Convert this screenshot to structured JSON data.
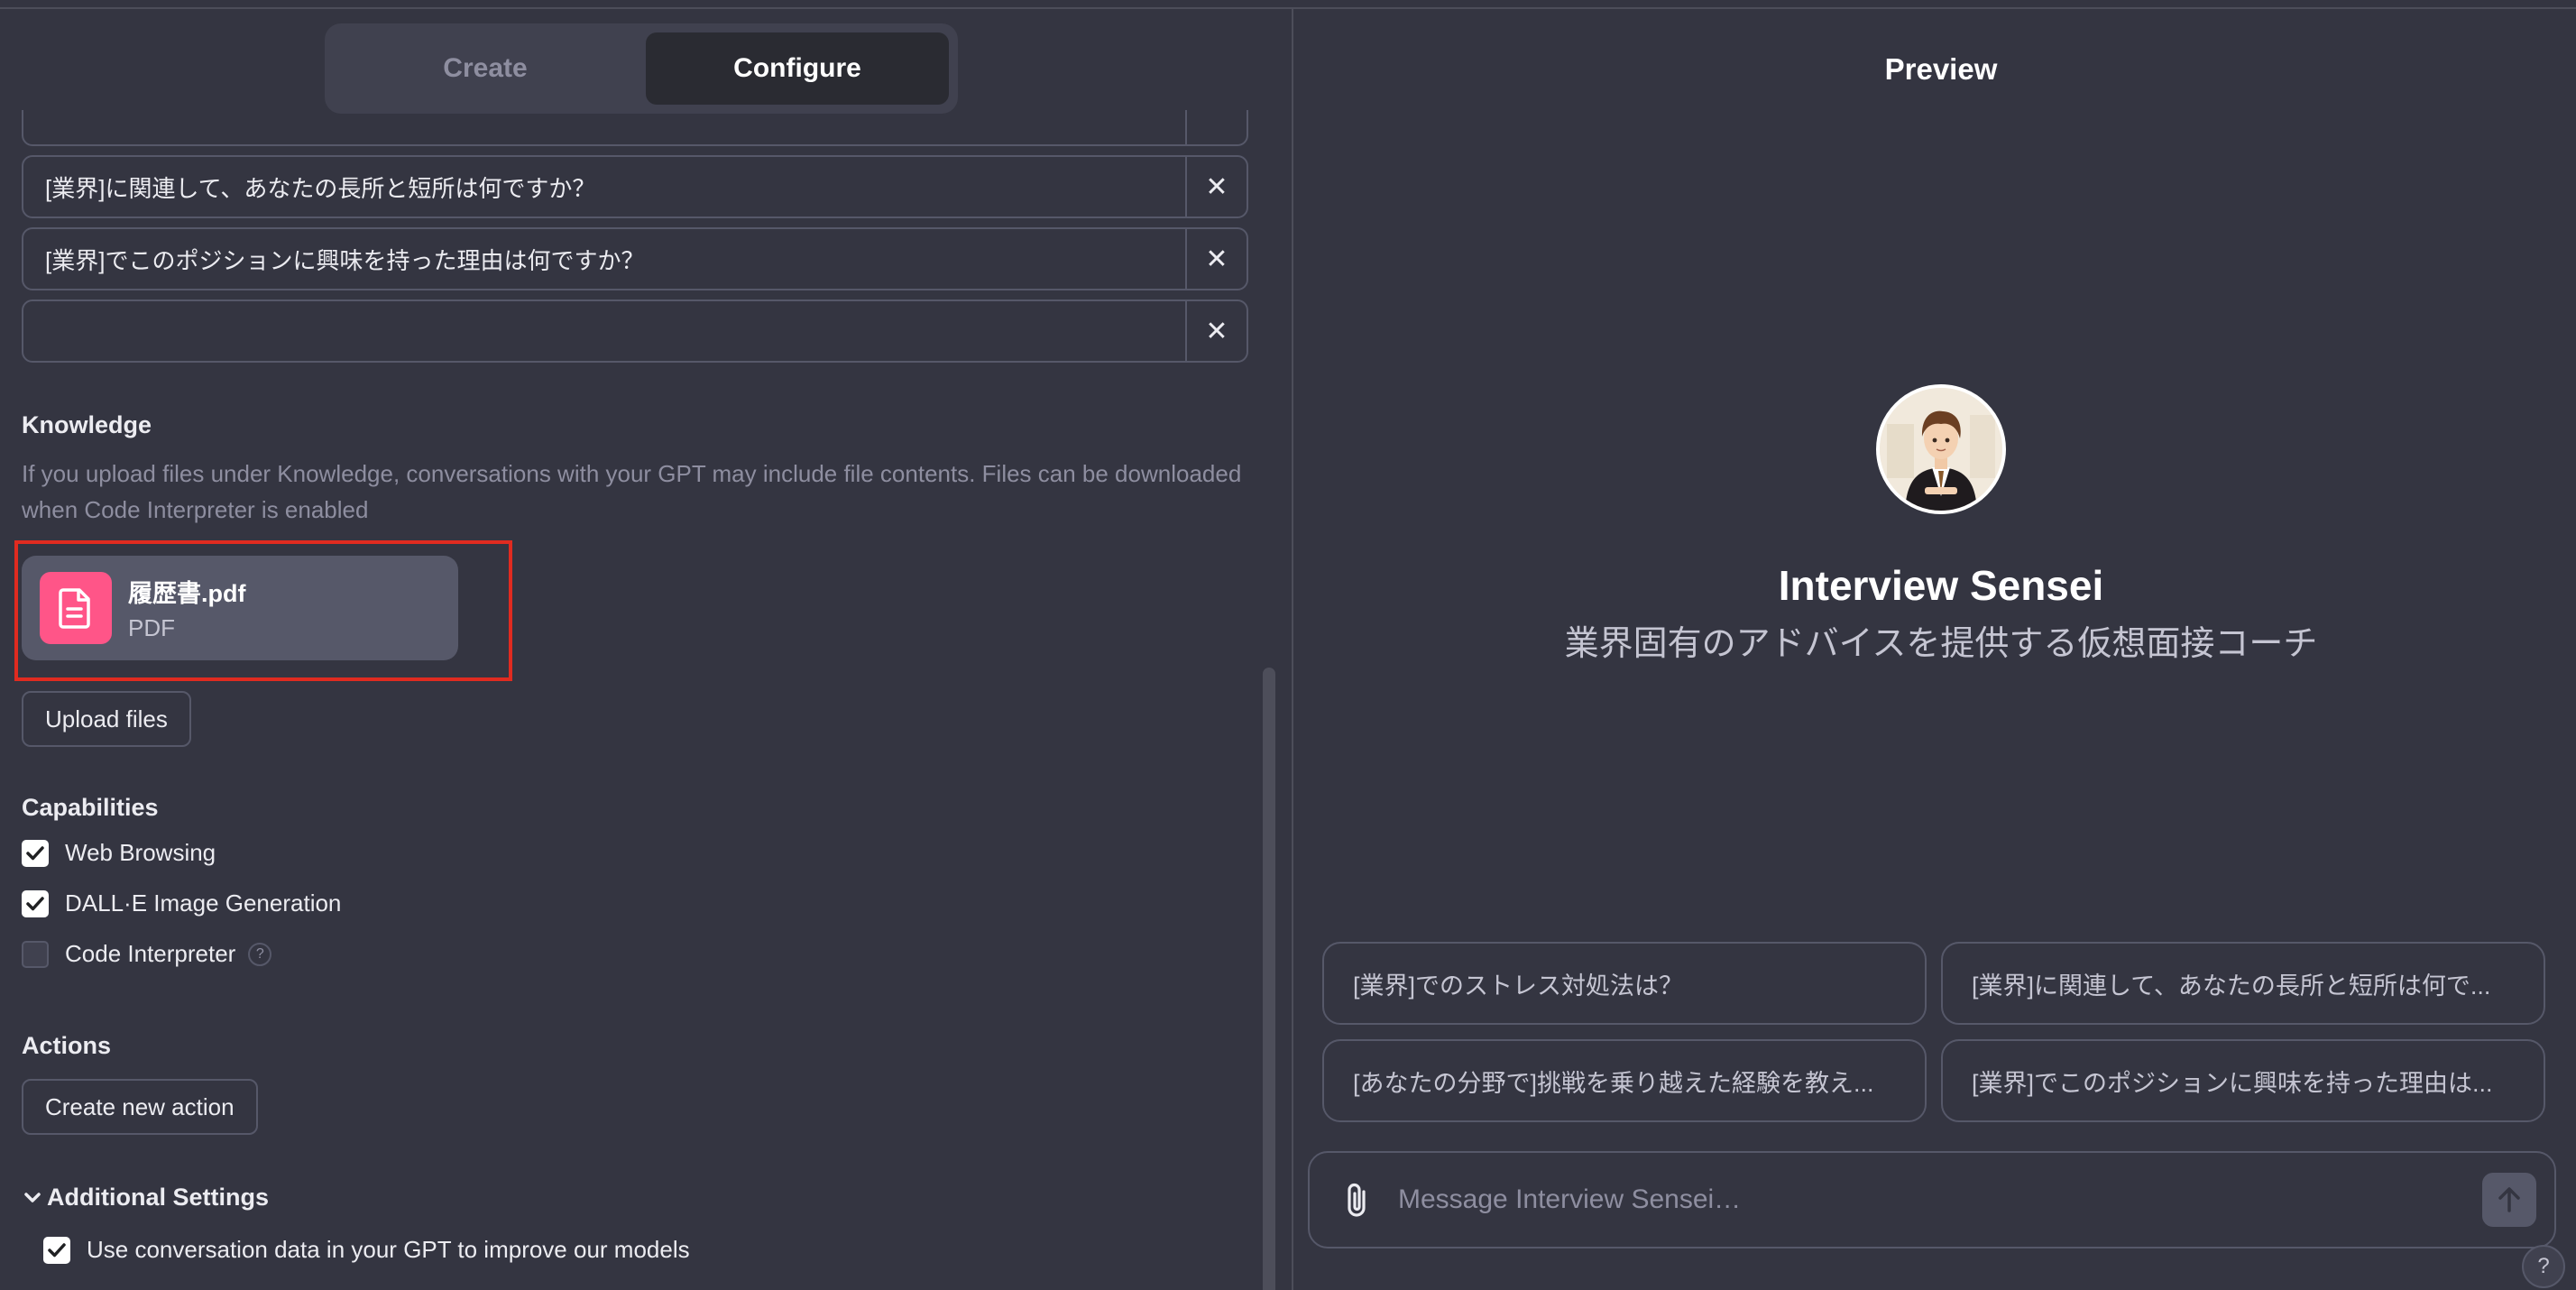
{
  "tabs": {
    "create": "Create",
    "configure": "Configure"
  },
  "starters": [
    "[業界]に関連して、あなたの長所と短所は何ですか？",
    "[業界]でこのポジションに興味を持った理由は何ですか？",
    ""
  ],
  "knowledge": {
    "title": "Knowledge",
    "description": "If you upload files under Knowledge, conversations with your GPT may include file contents. Files can be downloaded when Code Interpreter is enabled",
    "file": {
      "name": "履歴書.pdf",
      "type": "PDF"
    },
    "upload_label": "Upload files"
  },
  "capabilities": {
    "title": "Capabilities",
    "items": [
      {
        "label": "Web Browsing",
        "checked": true
      },
      {
        "label": "DALL·E Image Generation",
        "checked": true
      },
      {
        "label": "Code Interpreter",
        "checked": false
      }
    ],
    "help": "?"
  },
  "actions": {
    "title": "Actions",
    "button": "Create new action"
  },
  "additional": {
    "title": "Additional Settings",
    "use_data_label": "Use conversation data in your GPT to improve our models"
  },
  "preview": {
    "title": "Preview",
    "gpt_name": "Interview Sensei",
    "gpt_description": "業界固有のアドバイスを提供する仮想面接コーチ",
    "suggestions": [
      "[業界]でのストレス対処法は？",
      "[業界]に関連して、あなたの長所と短所は何で...",
      "[あなたの分野で]挑戦を乗り越えた経験を教え...",
      "[業界]でこのポジションに興味を持った理由は..."
    ],
    "message_placeholder": "Message Interview Sensei…",
    "help": "?"
  },
  "colors": {
    "accent_red_box": "#e02b20",
    "file_icon": "#ff5588",
    "background": "#343541"
  }
}
